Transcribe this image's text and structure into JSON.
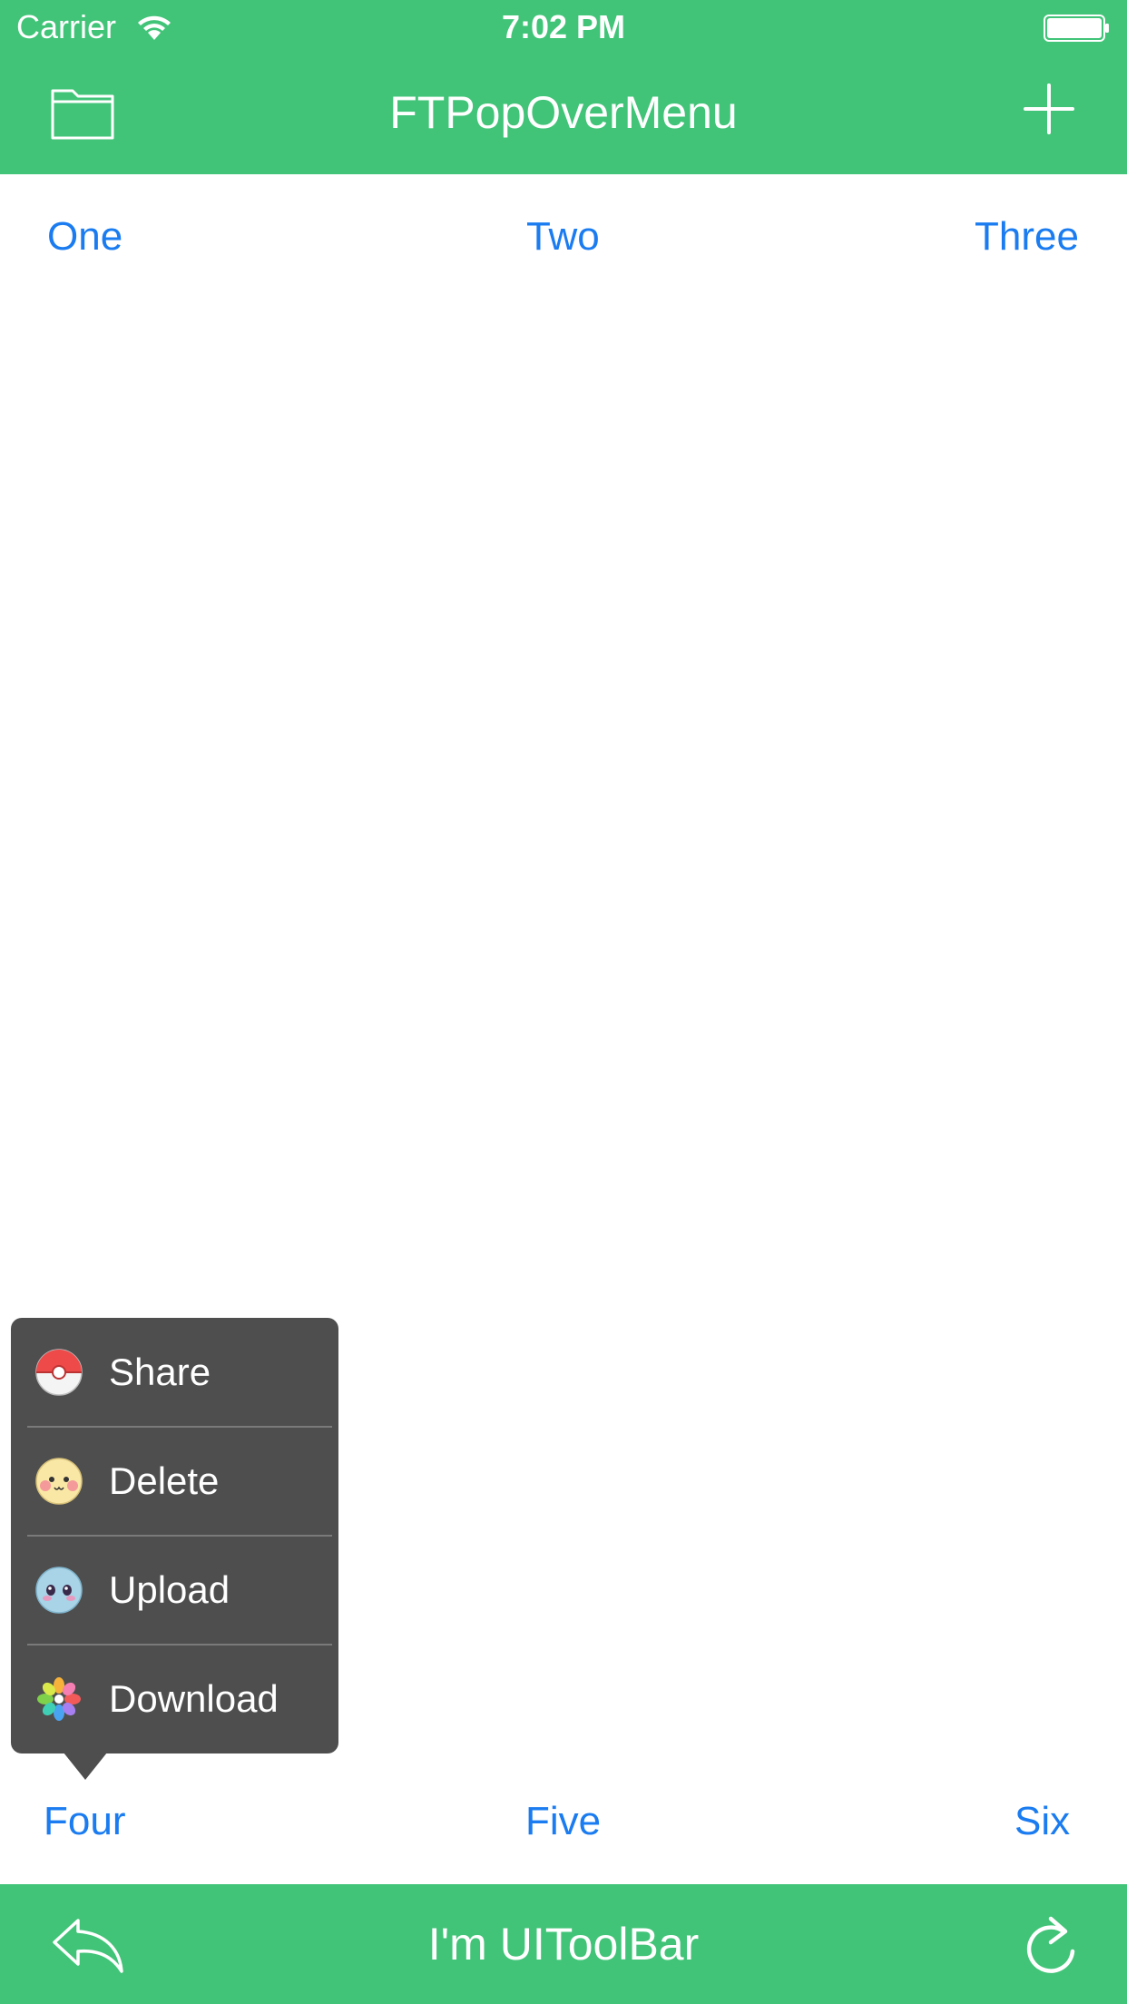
{
  "status_bar": {
    "carrier": "Carrier",
    "time": "7:02 PM"
  },
  "nav": {
    "title": "FTPopOverMenu",
    "left_icon": "folder-icon",
    "right_icon": "plus-icon"
  },
  "buttons_top": [
    "One",
    "Two",
    "Three"
  ],
  "buttons_bottom": [
    "Four",
    "Five",
    "Six"
  ],
  "popover_menu": {
    "items": [
      {
        "label": "Share",
        "icon": "pokeball-icon"
      },
      {
        "label": "Delete",
        "icon": "blush-face-icon"
      },
      {
        "label": "Upload",
        "icon": "blue-face-icon"
      },
      {
        "label": "Download",
        "icon": "flower-icon"
      }
    ]
  },
  "toolbar": {
    "title": "I'm UIToolBar",
    "left_icon": "reply-icon",
    "right_icon": "refresh-icon"
  },
  "colors": {
    "bar_green": "#41c478",
    "link_blue": "#1a7cf0",
    "menu_bg": "#4e4e4e"
  }
}
